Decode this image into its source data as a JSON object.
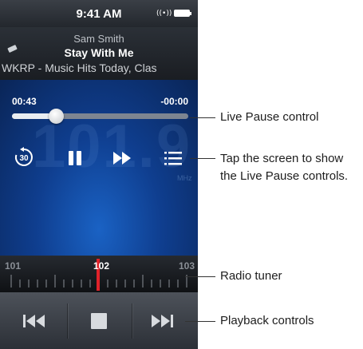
{
  "status_bar": {
    "time": "9:41 AM",
    "airplay_icon": "airplay-icon",
    "battery_icon": "battery-icon"
  },
  "now_playing": {
    "artist": "Sam Smith",
    "song": "Stay With Me",
    "station": "WKRP - Music Hits Today, Clas",
    "tag_icon": "tag-icon"
  },
  "live_pause": {
    "elapsed": "00:43",
    "remaining": "-00:00",
    "progress": 0.25,
    "frequency_ghost": "101.9",
    "unit_ghost": "MHz",
    "controls": {
      "skip_back_label": "30",
      "skip_back_icon": "skip-back-30-icon",
      "pause_icon": "pause-icon",
      "fast_forward_icon": "fast-forward-icon",
      "list_icon": "list-icon"
    }
  },
  "tuner": {
    "labels": [
      "101",
      "102",
      "103"
    ],
    "selected": "102"
  },
  "playback": {
    "previous_icon": "previous-track-icon",
    "stop_icon": "stop-icon",
    "next_icon": "next-track-icon"
  },
  "callouts": {
    "live_pause": "Live Pause control",
    "tap_screen_line1": "Tap the screen to show",
    "tap_screen_line2": "the Live Pause controls.",
    "radio_tuner": "Radio tuner",
    "playback_controls": "Playback controls"
  },
  "colors": {
    "accent_blue": "#1a62c4",
    "tuner_needle": "#e0222a",
    "text_dark": "#1d1d1d"
  }
}
